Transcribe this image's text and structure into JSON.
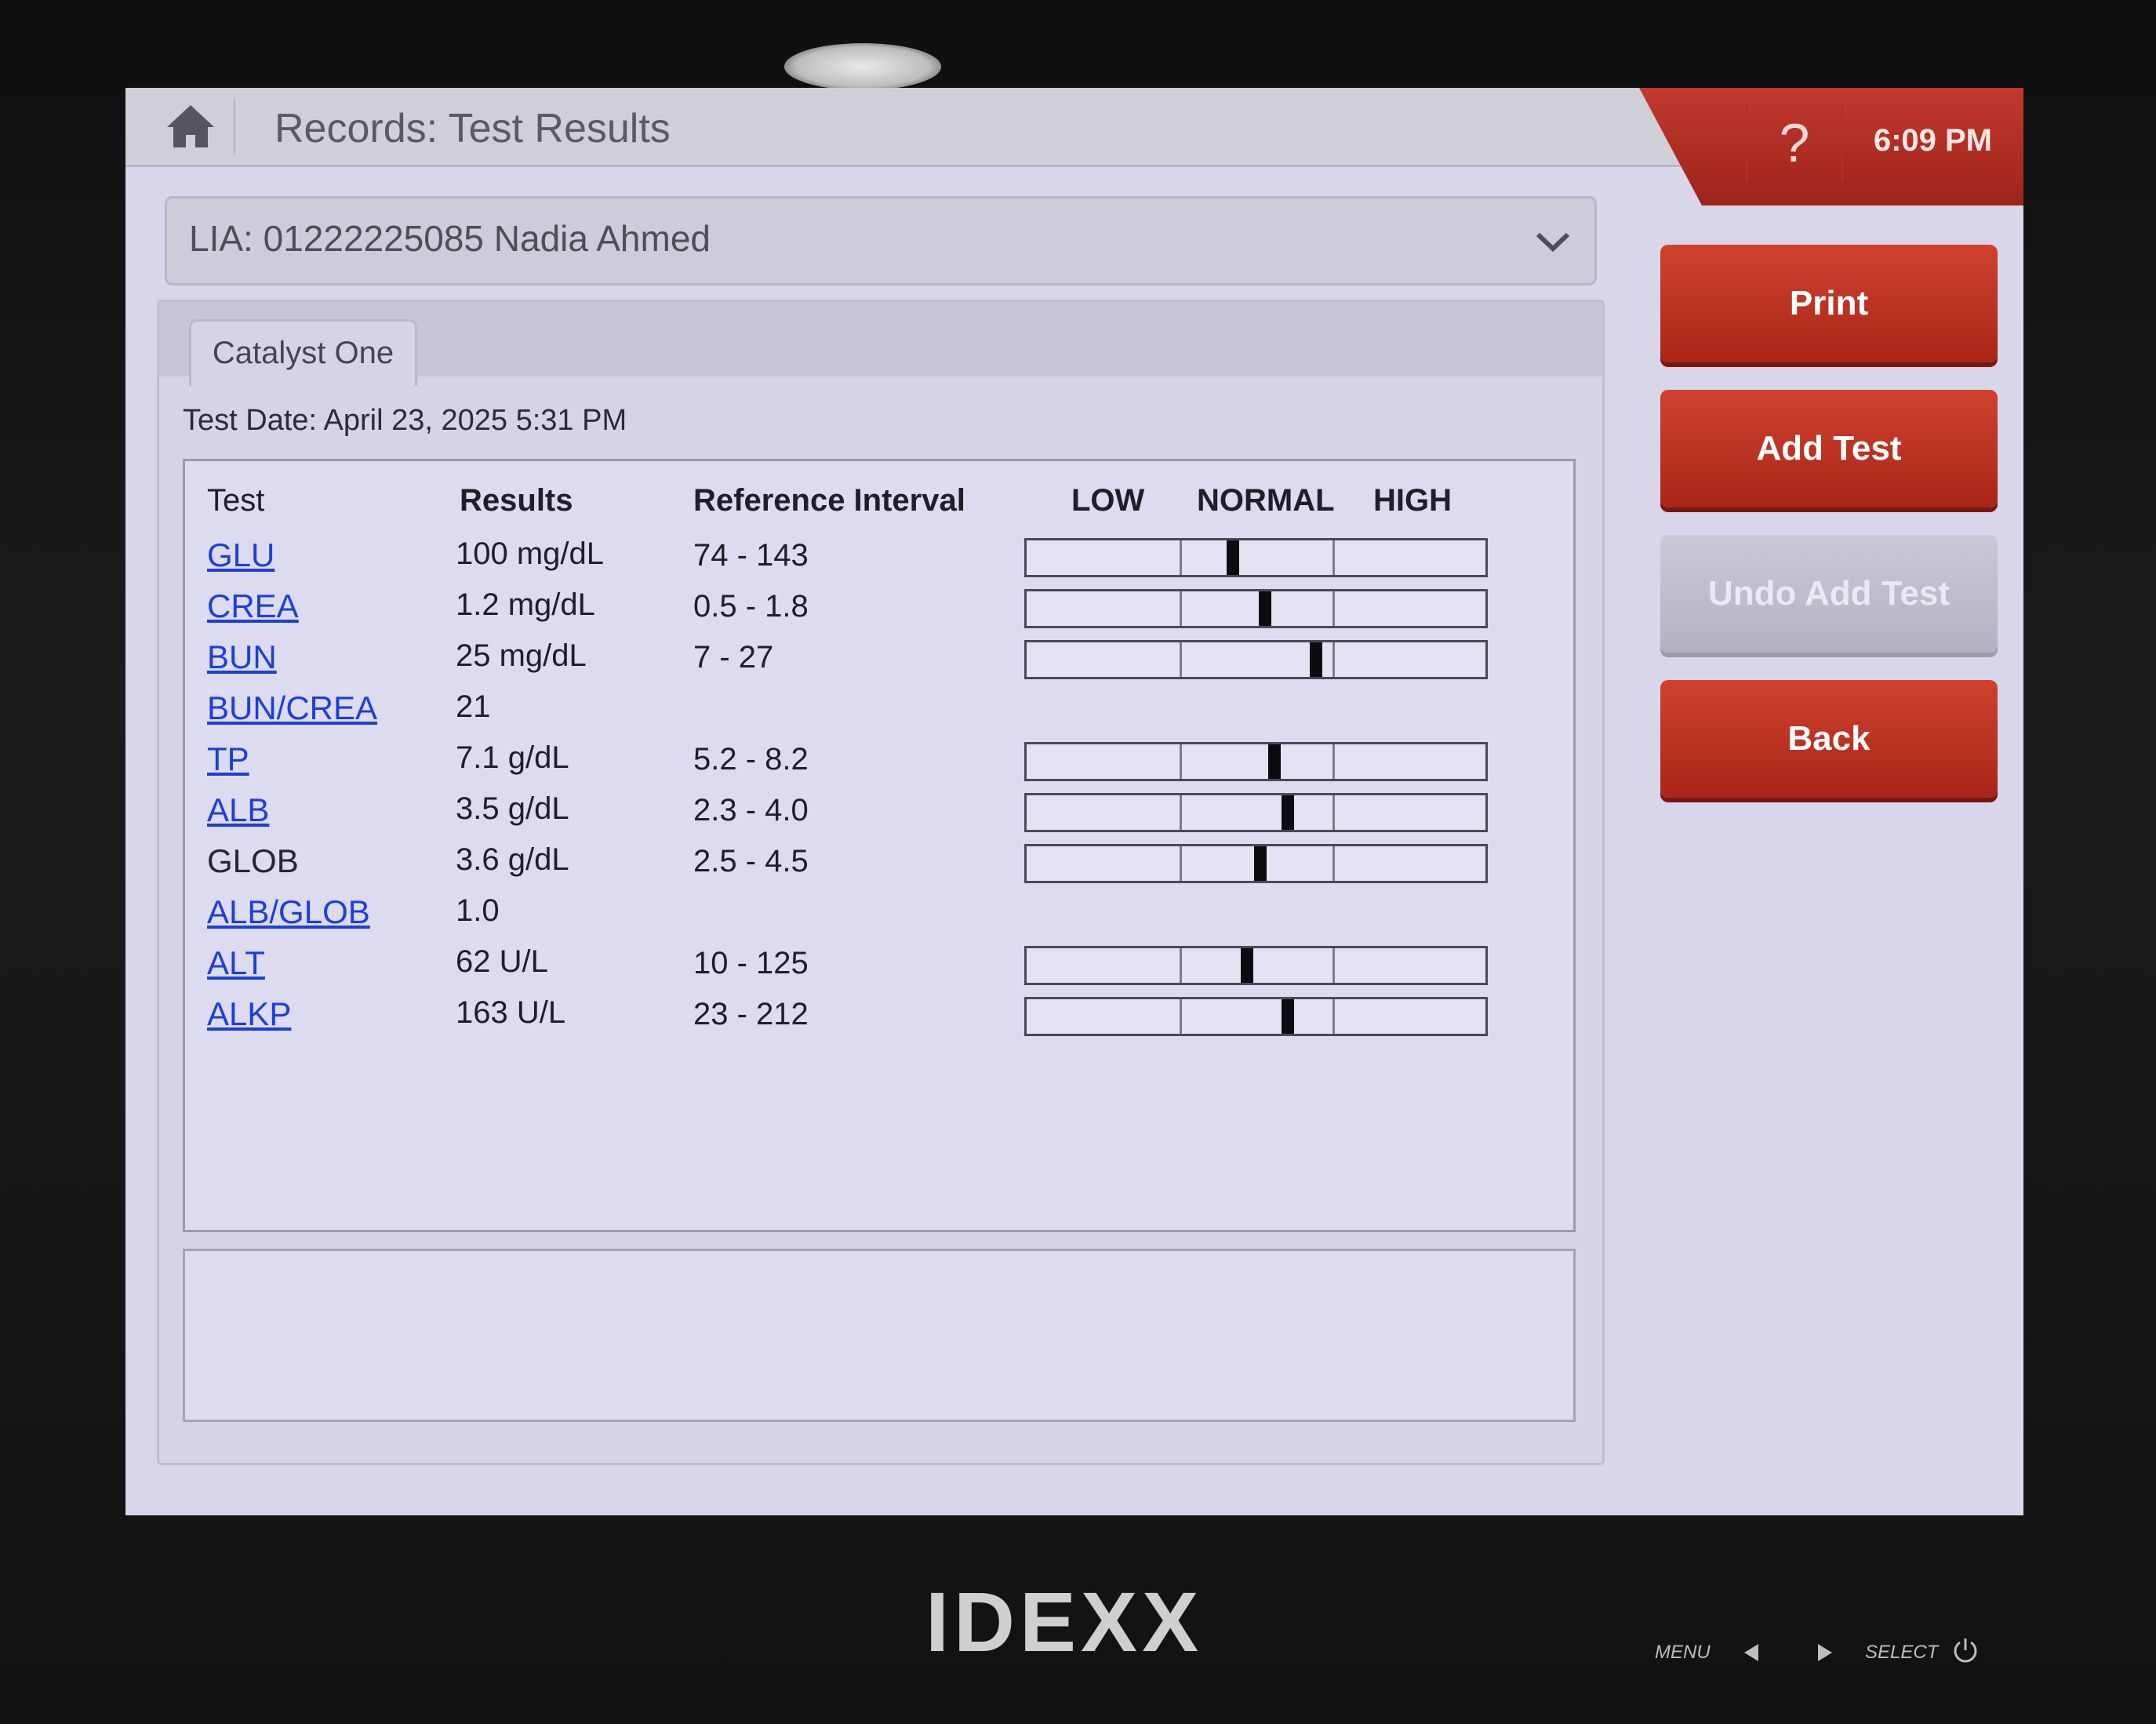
{
  "header": {
    "page_title": "Records: Test Results",
    "help_label": "?",
    "time": "6:09 PM",
    "icons": {
      "home": "home-icon",
      "help": "help-icon"
    }
  },
  "patient_selector": {
    "value": "LIA: 01222225085 Nadia Ahmed",
    "icon": "chevron-down-icon"
  },
  "tabs": [
    {
      "label": "Catalyst One",
      "active": true
    }
  ],
  "test_date": "Test Date: April 23, 2025 5:31 PM",
  "table": {
    "headers": {
      "test": "Test",
      "results": "Results",
      "reference": "Reference Interval",
      "low": "LOW",
      "normal": "NORMAL",
      "high": "HIGH"
    },
    "rows": [
      {
        "name": "GLU",
        "result": "100 mg/dL",
        "reference": "74 - 143",
        "link": true,
        "level": 0.45
      },
      {
        "name": "CREA",
        "result": "1.2 mg/dL",
        "reference": "0.5 - 1.8",
        "link": true,
        "level": 0.52
      },
      {
        "name": "BUN",
        "result": "25 mg/dL",
        "reference": "7 - 27",
        "link": true,
        "level": 0.63
      },
      {
        "name": "BUN/CREA",
        "result": "21",
        "reference": "",
        "link": true,
        "level": null
      },
      {
        "name": "TP",
        "result": "7.1 g/dL",
        "reference": "5.2 - 8.2",
        "link": true,
        "level": 0.54
      },
      {
        "name": "ALB",
        "result": "3.5 g/dL",
        "reference": "2.3 - 4.0",
        "link": true,
        "level": 0.57
      },
      {
        "name": "GLOB",
        "result": "3.6 g/dL",
        "reference": "2.5 - 4.5",
        "link": false,
        "level": 0.51
      },
      {
        "name": "ALB/GLOB",
        "result": "1.0",
        "reference": "",
        "link": true,
        "level": null
      },
      {
        "name": "ALT",
        "result": "62 U/L",
        "reference": "10 - 125",
        "link": true,
        "level": 0.48
      },
      {
        "name": "ALKP",
        "result": "163 U/L",
        "reference": "23 - 212",
        "link": true,
        "level": 0.57
      }
    ]
  },
  "buttons": {
    "print": "Print",
    "add_test": "Add Test",
    "undo_add_test": "Undo Add Test",
    "back": "Back"
  },
  "device": {
    "brand": "IDEXX",
    "menu": "MENU",
    "select": "SELECT",
    "icons": {
      "left": "triangle-left-icon",
      "right": "triangle-right-icon",
      "power": "power-icon"
    }
  },
  "colors": {
    "accent_red": "#b8322a",
    "link_blue": "#1e3fd6",
    "screen_bg": "#d7d6ea"
  }
}
